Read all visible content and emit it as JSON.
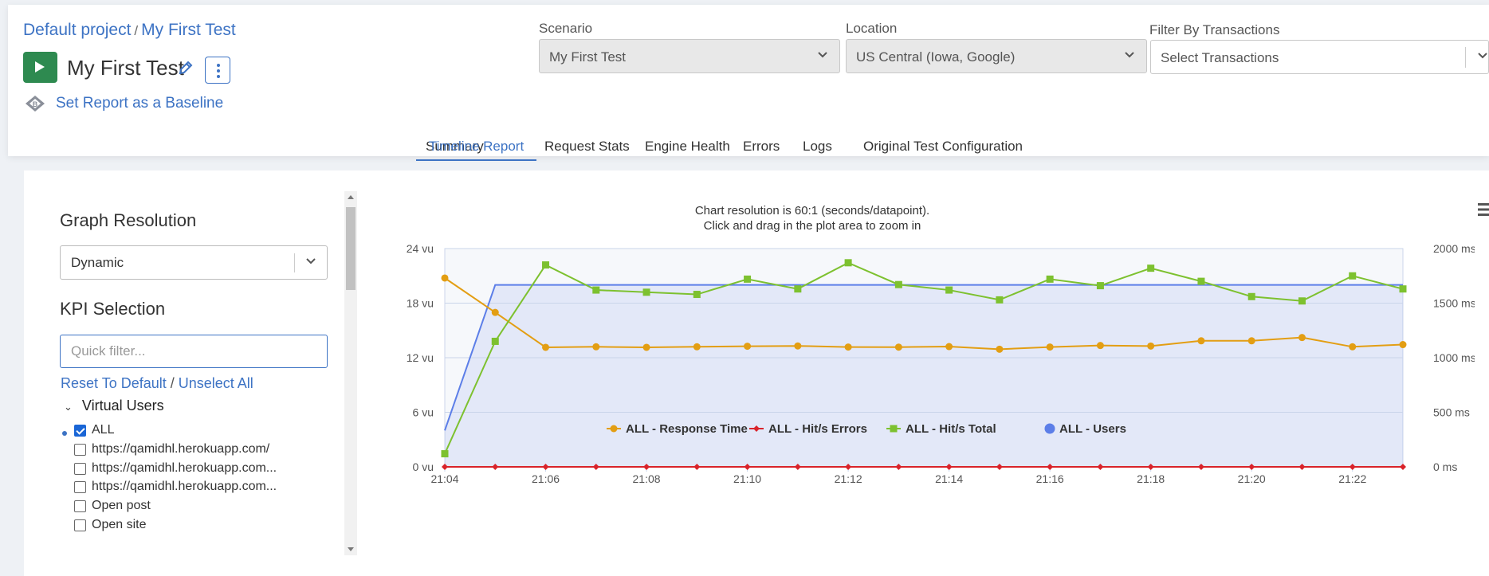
{
  "header": {
    "breadcrumb_project": "Default project",
    "breadcrumb_sep": "/",
    "breadcrumb_test": "My First Test",
    "test_title": "My First Test",
    "baseline_link": "Set Report as a Baseline"
  },
  "filters": {
    "scenario_label": "Scenario",
    "scenario_value": "My First Test",
    "location_label": "Location",
    "location_value": "US Central (Iowa, Google)",
    "transactions_label": "Filter By Transactions",
    "transactions_placeholder": "Select Transactions"
  },
  "tabs": [
    {
      "label": "Summary"
    },
    {
      "label": "Timeline Report"
    },
    {
      "label": "Request Stats"
    },
    {
      "label": "Engine Health"
    },
    {
      "label": "Errors"
    },
    {
      "label": "Logs"
    },
    {
      "label": "Original Test Configuration"
    }
  ],
  "active_tab": "Timeline Report",
  "sidebar": {
    "graph_resolution_title": "Graph Resolution",
    "graph_resolution_value": "Dynamic",
    "kpi_title": "KPI Selection",
    "quick_filter_placeholder": "Quick filter...",
    "reset_link": "Reset To Default",
    "link_sep": "/",
    "unselect_link": "Unselect All",
    "group_label": "Virtual Users",
    "items": [
      {
        "label": "ALL",
        "checked": true
      },
      {
        "label": "https://qamidhl.herokuapp.com/",
        "checked": false
      },
      {
        "label": "https://qamidhl.herokuapp.com...",
        "checked": false
      },
      {
        "label": "https://qamidhl.herokuapp.com...",
        "checked": false
      },
      {
        "label": "Open post",
        "checked": false
      },
      {
        "label": "Open site",
        "checked": false
      }
    ]
  },
  "chart_note": {
    "line1": "Chart resolution is 60:1 (seconds/datapoint).",
    "line2": "Click and drag in the plot area to zoom in"
  },
  "chart_data": {
    "type": "line",
    "x": [
      "21:04",
      "21:05",
      "21:06",
      "21:07",
      "21:08",
      "21:09",
      "21:10",
      "21:11",
      "21:12",
      "21:13",
      "21:14",
      "21:15",
      "21:16",
      "21:17",
      "21:18",
      "21:19",
      "21:20",
      "21:21",
      "21:22",
      "21:23"
    ],
    "x_tick_labels": [
      "21:04",
      "21:06",
      "21:08",
      "21:10",
      "21:12",
      "21:14",
      "21:16",
      "21:18",
      "21:20",
      "21:22"
    ],
    "y_left_ticks": [
      "0 vu",
      "6 vu",
      "12 vu",
      "18 vu",
      "24 vu"
    ],
    "y_left_range": [
      0,
      24
    ],
    "y_right_ms_ticks": [
      "0 ms",
      "500 ms",
      "1000 ms",
      "1500 ms",
      "2000 ms"
    ],
    "y_right_ms_range": [
      0,
      2000
    ],
    "y_right_hits_ticks": [
      "0",
      "0.5",
      "1",
      "1.5",
      "2"
    ],
    "y_right_hits_range": [
      0,
      2
    ],
    "grid": true,
    "legend_position": "bottom",
    "series": [
      {
        "name": "ALL - Response Time",
        "axis": "ms",
        "color": "#e39e13",
        "marker": "circle",
        "values": [
          1730,
          1415,
          1095,
          1100,
          1095,
          1100,
          1105,
          1108,
          1098,
          1097,
          1102,
          1078,
          1098,
          1112,
          1107,
          1155,
          1155,
          1185,
          1100,
          1120
        ]
      },
      {
        "name": "ALL - Hit/s Errors",
        "axis": "hits",
        "color": "#d9232a",
        "marker": "diamond",
        "values": [
          0,
          0,
          0,
          0,
          0,
          0,
          0,
          0,
          0,
          0,
          0,
          0,
          0,
          0,
          0,
          0,
          0,
          0,
          0,
          0
        ]
      },
      {
        "name": "ALL - Hit/s Total",
        "axis": "hits",
        "color": "#7dc12f",
        "marker": "square",
        "values": [
          0.12,
          1.15,
          1.85,
          1.62,
          1.6,
          1.58,
          1.72,
          1.63,
          1.87,
          1.67,
          1.62,
          1.53,
          1.72,
          1.66,
          1.82,
          1.7,
          1.56,
          1.52,
          1.75,
          1.63
        ]
      },
      {
        "name": "ALL - Users",
        "axis": "vu",
        "color": "#5c7ee8",
        "marker": "dot",
        "values": [
          4,
          20,
          20,
          20,
          20,
          20,
          20,
          20,
          20,
          20,
          20,
          20,
          20,
          20,
          20,
          20,
          20,
          20,
          20,
          20
        ]
      }
    ]
  }
}
